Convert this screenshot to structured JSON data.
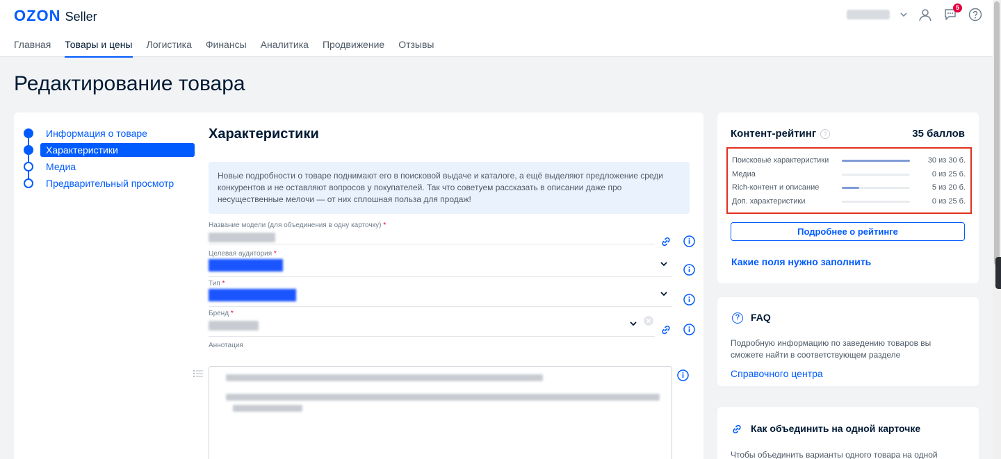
{
  "header": {
    "logo_brand": "OZON",
    "logo_suffix": "Seller",
    "notification_count": "5"
  },
  "nav": {
    "tabs": [
      {
        "label": "Главная"
      },
      {
        "label": "Товары и цены"
      },
      {
        "label": "Логистика"
      },
      {
        "label": "Финансы"
      },
      {
        "label": "Аналитика"
      },
      {
        "label": "Продвижение"
      },
      {
        "label": "Отзывы"
      }
    ]
  },
  "page": {
    "title": "Редактирование товара"
  },
  "steps": [
    {
      "label": "Информация о товаре"
    },
    {
      "label": "Характеристики"
    },
    {
      "label": "Медиа"
    },
    {
      "label": "Предварительный просмотр"
    }
  ],
  "form": {
    "section_title": "Характеристики",
    "info_text": "Новые подробности о товаре поднимают его в поисковой выдаче и каталоге, а ещё выделяют предложение среди конкурентов и не оставляют вопросов у покупателей. Так что советуем рассказать в описании даже про несущественные мелочи — от них сплошная польза для продаж!",
    "fields": {
      "model_name": {
        "label": "Название модели (для объединения в одну карточку)"
      },
      "audience": {
        "label": "Целевая аудитория"
      },
      "type": {
        "label": "Тип"
      },
      "brand": {
        "label": "Бренд"
      },
      "annotation": {
        "label": "Аннотация"
      }
    }
  },
  "rating": {
    "title": "Контент-рейтинг",
    "score": "35 баллов",
    "rows": [
      {
        "name": "Поисковые характеристики",
        "value": "30 из 30 б.",
        "fraction": 1.0
      },
      {
        "name": "Медиа",
        "value": "0 из 25 б.",
        "fraction": 0.0
      },
      {
        "name": "Rich-контент и описание",
        "value": "5 из 20 б.",
        "fraction": 0.25
      },
      {
        "name": "Доп. характеристики",
        "value": "0 из 25 б.",
        "fraction": 0.0
      }
    ],
    "details_button": "Подробнее о рейтинге",
    "fields_link": "Какие поля нужно заполнить"
  },
  "faq": {
    "title": "FAQ",
    "text": "Подробную информацию по заведению товаров вы сможете найти в соответствующем разделе",
    "link": "Справочного центра"
  },
  "merge": {
    "title": "Как объединить на одной карточке",
    "text": "Чтобы объединить варианты одного товара на одной"
  }
}
